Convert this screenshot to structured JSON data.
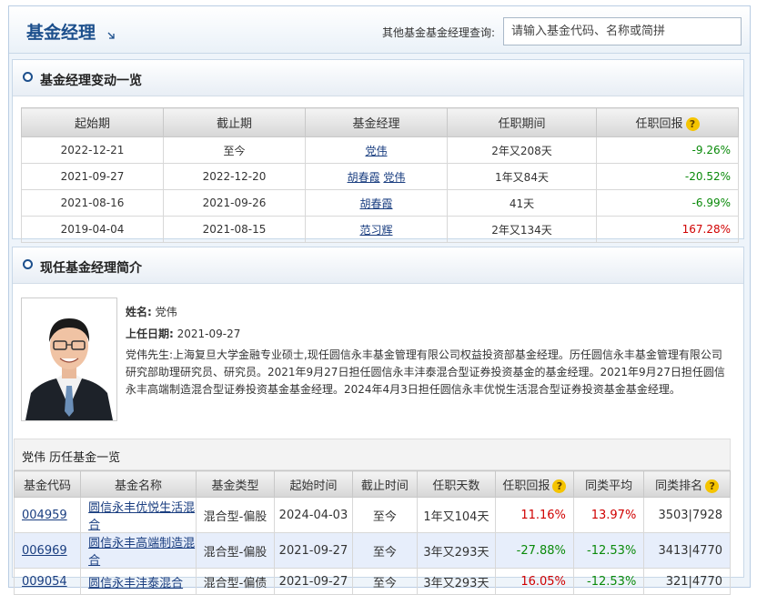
{
  "header": {
    "title": "基金经理",
    "search_label": "其他基金基金经理查询:",
    "search_placeholder": "请输入基金代码、名称或简拼"
  },
  "changes": {
    "title": "基金经理变动一览",
    "columns": [
      "起始期",
      "截止期",
      "基金经理",
      "任职期间",
      "任职回报"
    ],
    "rows": [
      {
        "start": "2022-12-21",
        "end": "至今",
        "managers": [
          "党伟"
        ],
        "period": "2年又208天",
        "ret": "-9.26%",
        "ret_color": "#0a8a0a"
      },
      {
        "start": "2021-09-27",
        "end": "2022-12-20",
        "managers": [
          "胡春霞",
          "党伟"
        ],
        "period": "1年又84天",
        "ret": "-20.52%",
        "ret_color": "#0a8a0a"
      },
      {
        "start": "2021-08-16",
        "end": "2021-09-26",
        "managers": [
          "胡春霞"
        ],
        "period": "41天",
        "ret": "-6.99%",
        "ret_color": "#0a8a0a"
      },
      {
        "start": "2019-04-04",
        "end": "2021-08-15",
        "managers": [
          "范习辉"
        ],
        "period": "2年又134天",
        "ret": "167.28%",
        "ret_color": "#d00000"
      }
    ]
  },
  "profile": {
    "title": "现任基金经理简介",
    "name_label": "姓名:",
    "name": "党伟",
    "date_label": "上任日期:",
    "date": "2021-09-27",
    "bio": "党伟先生:上海复旦大学金融专业硕士,现任圆信永丰基金管理有限公司权益投资部基金经理。历任圆信永丰基金管理有限公司研究部助理研究员、研究员。2021年9月27日担任圆信永丰沣泰混合型证券投资基金的基金经理。2021年9月27日担任圆信永丰高端制造混合型证券投资基金基金经理。2024年4月3日担任圆信永丰优悦生活混合型证券投资基金基金经理。"
  },
  "history": {
    "title": "党伟 历任基金一览",
    "columns": [
      "基金代码",
      "基金名称",
      "基金类型",
      "起始时间",
      "截止时间",
      "任职天数",
      "任职回报",
      "同类平均",
      "同类排名"
    ],
    "rows": [
      {
        "code": "004959",
        "name": "圆信永丰优悦生活混合",
        "type": "混合型-偏股",
        "start": "2024-04-03",
        "end": "至今",
        "days": "1年又104天",
        "ret": "11.16%",
        "ret_color": "#d00000",
        "avg": "13.97%",
        "avg_color": "#d00000",
        "rank": "3503|7928"
      },
      {
        "code": "006969",
        "name": "圆信永丰高端制造混合",
        "type": "混合型-偏股",
        "start": "2021-09-27",
        "end": "至今",
        "days": "3年又293天",
        "ret": "-27.88%",
        "ret_color": "#0a8a0a",
        "avg": "-12.53%",
        "avg_color": "#0a8a0a",
        "rank": "3413|4770",
        "highlight": true
      },
      {
        "code": "009054",
        "name": "圆信永丰沣泰混合",
        "type": "混合型-偏债",
        "start": "2021-09-27",
        "end": "至今",
        "days": "3年又293天",
        "ret": "16.05%",
        "ret_color": "#d00000",
        "avg": "-12.53%",
        "avg_color": "#0a8a0a",
        "rank": "321|4770"
      }
    ]
  },
  "icons": {
    "help": "?",
    "title_arrow": "arrow-down-right-icon",
    "panel_bullet": "circle-bullet-icon",
    "photo": "manager-portrait"
  }
}
